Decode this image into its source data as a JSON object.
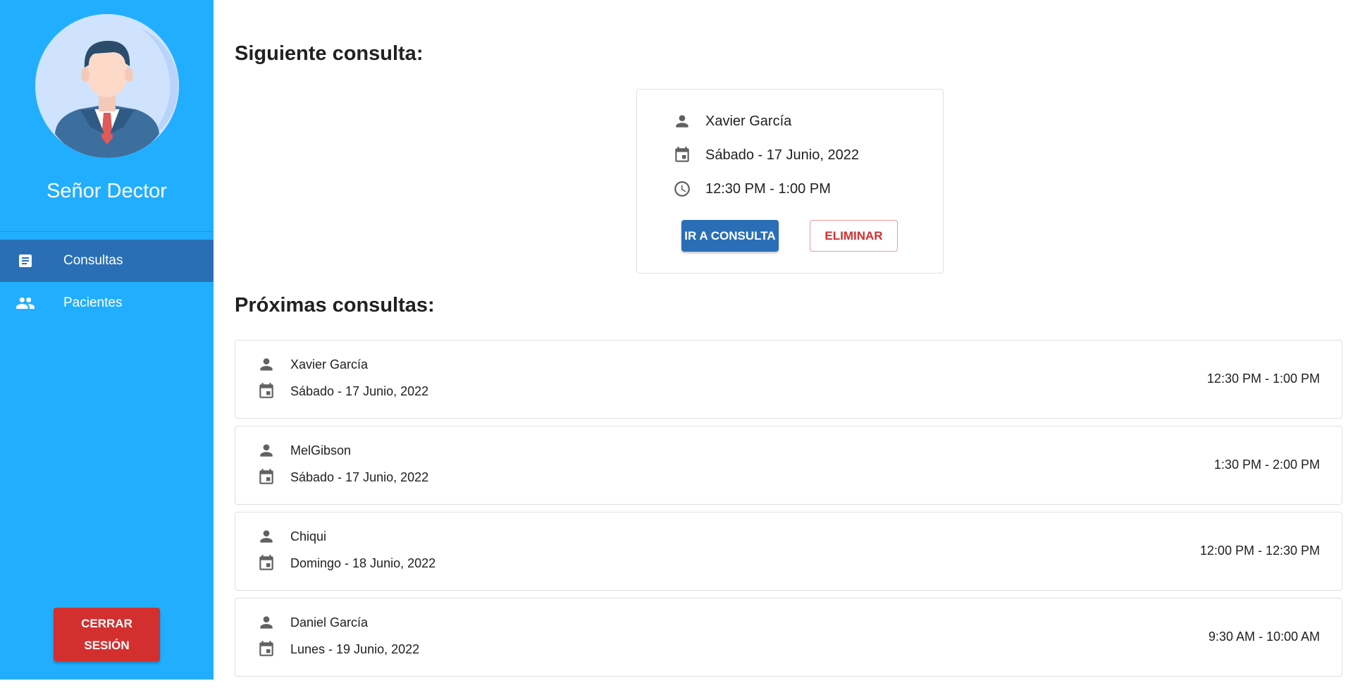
{
  "sidebar": {
    "user_name": "Señor Dector",
    "nav": [
      {
        "label": "Consultas",
        "icon": "document-icon",
        "active": true
      },
      {
        "label": "Pacientes",
        "icon": "people-icon",
        "active": false
      }
    ],
    "logout_line1": "CERRAR",
    "logout_line2": "SESIÓN"
  },
  "next": {
    "title": "Siguiente consulta:",
    "patient": "Xavier García",
    "date": "Sábado - 17 Junio, 2022",
    "time": "12:30 PM - 1:00 PM",
    "go_label": "IR A CONSULTA",
    "delete_label": "ELIMINAR"
  },
  "upcoming": {
    "title": "Próximas consultas:",
    "items": [
      {
        "patient": "Xavier García",
        "date": "Sábado - 17 Junio, 2022",
        "time": "12:30 PM - 1:00 PM"
      },
      {
        "patient": "MelGibson",
        "date": "Sábado - 17 Junio, 2022",
        "time": "1:30 PM - 2:00 PM"
      },
      {
        "patient": "Chiqui",
        "date": "Domingo - 18 Junio, 2022",
        "time": "12:00 PM - 12:30 PM"
      },
      {
        "patient": "Daniel García",
        "date": "Lunes - 19 Junio, 2022",
        "time": "9:30 AM - 10:00 AM"
      }
    ]
  },
  "colors": {
    "sidebar": "#22aefe",
    "active_nav": "#2a6fb5",
    "primary": "#2a6fb5",
    "danger": "#d32f2f",
    "icon_gray": "#616161"
  }
}
